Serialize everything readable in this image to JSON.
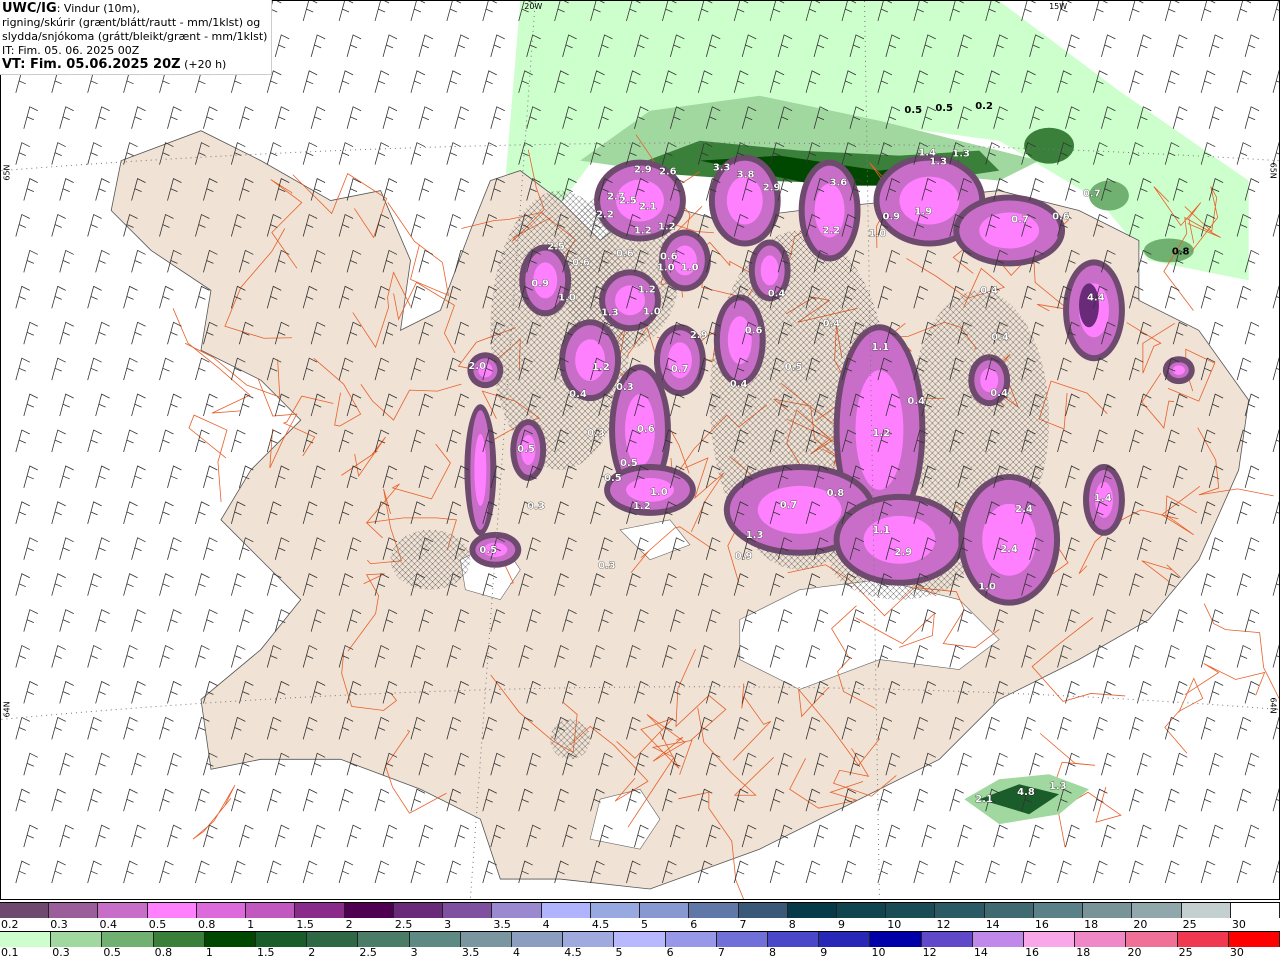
{
  "header": {
    "model": "UWC/IG",
    "line1": ": Vindur (10m),",
    "line2": "rigning/skúrir (grænt/blátt/rautt - mm/1klst) og",
    "line3": "slydda/snjókoma (grátt/bleikt/grænt - mm/1klst)",
    "it": "IT: Fim. 05. 06. 2025 00Z",
    "vt": "VT: Fim. 05.06.2025 20Z",
    "lead": " (+20 h)"
  },
  "graticule": {
    "lon_labels": [
      "20W",
      "15W"
    ],
    "lat_labels": [
      "65N",
      "64N"
    ]
  },
  "colors": {
    "land": "#f0e2d4",
    "roads": "#e8602a",
    "snow_white": "#ffffff"
  },
  "map_values": [
    "0.5",
    "0.5",
    "0.2",
    "2.9",
    "2.6",
    "3.3",
    "3.8",
    "2.9",
    "3.6",
    "1.4",
    "1.3",
    "1.3",
    "2.7",
    "2.5",
    "2.1",
    "2.2",
    "1.2",
    "1.2",
    "2.2",
    "1.0",
    "0.9",
    "1.9",
    "0.7",
    "0.6",
    "0.7",
    "0.8",
    "0.4",
    "2.5",
    "0.6",
    "0.9",
    "1.0",
    "1.0",
    "1.3",
    "0.6",
    "1.2",
    "1.0",
    "0.6",
    "1.0",
    "0.4",
    "0.4",
    "0.6",
    "2.9",
    "0.4",
    "4.4",
    "1.1",
    "2.0",
    "1.2",
    "0.4",
    "0.3",
    "0.5",
    "0.7",
    "0.6",
    "0.4",
    "0.5",
    "1.0",
    "1.2",
    "0.3",
    "0.5",
    "0.3",
    "0.5",
    "0.7",
    "0.8",
    "1.2",
    "1.1",
    "2.9",
    "2.4",
    "2.4",
    "1.0",
    "1.4",
    "1.3",
    "0.9",
    "0.3",
    "0.4",
    "0.4",
    "0.5",
    "2.1",
    "4.8",
    "1.3"
  ],
  "legend": {
    "snow": {
      "labels": [
        "0.2",
        "0.3",
        "0.4",
        "0.5",
        "0.8",
        "1",
        "1.5",
        "2",
        "2.5",
        "3",
        "3.5",
        "4",
        "4.5",
        "5",
        "6",
        "7",
        "8",
        "9",
        "10",
        "12",
        "14",
        "16",
        "18",
        "20",
        "25",
        "30"
      ],
      "colors": [
        "#6e4a6e",
        "#9a5f9a",
        "#c86ec8",
        "#ff80ff",
        "#dc6adc",
        "#c058c0",
        "#8a2a8a",
        "#500050",
        "#6a2a7a",
        "#8050a0",
        "#9a88d0",
        "#b0b4ff",
        "#98a8e0",
        "#8898d0",
        "#6078a8",
        "#3a5878",
        "#073a48",
        "#10444f",
        "#1a4c56",
        "#2a5a64",
        "#3f6a72",
        "#5a8088",
        "#789498",
        "#90a8ac",
        "#c4d0d0",
        "#ffffff"
      ]
    },
    "rain": {
      "labels": [
        "0.1",
        "0.3",
        "0.5",
        "0.8",
        "1",
        "1.5",
        "2",
        "2.5",
        "3",
        "3.5",
        "4",
        "4.5",
        "5",
        "6",
        "7",
        "8",
        "9",
        "10",
        "12",
        "14",
        "16",
        "18",
        "20",
        "25",
        "30"
      ],
      "colors": [
        "#ccffcc",
        "#a0d8a0",
        "#70b070",
        "#3a803a",
        "#004800",
        "#1a5c2a",
        "#2e6844",
        "#4a7c68",
        "#5e8a84",
        "#7a96a0",
        "#8c9ec0",
        "#a0aade",
        "#b8b8ff",
        "#9898e8",
        "#7070d8",
        "#4848c8",
        "#2828b8",
        "#0000a8",
        "#6048c8",
        "#c088e8",
        "#f8a8e8",
        "#f088c8",
        "#f07098",
        "#f03850",
        "#ff0000"
      ]
    }
  }
}
